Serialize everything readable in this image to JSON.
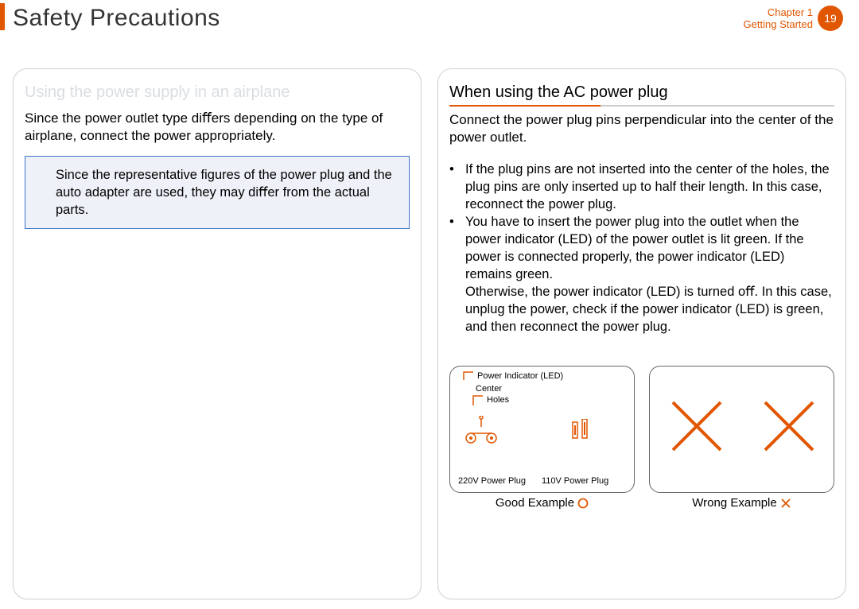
{
  "page": {
    "title": "Safety Precautions",
    "chapter_line1": "Chapter 1",
    "chapter_line2": "Getting Started",
    "page_number": "19"
  },
  "left": {
    "heading": "Using the power supply in an airplane",
    "intro": "Since the power outlet type diﬀers depending on the type of airplane, connect the power appropriately.",
    "note": "Since the representative ﬁgures of the power plug and the auto adapter are used, they may diﬀer from the actual parts."
  },
  "right": {
    "heading": "When using the AC power plug",
    "intro": "Connect the power plug pins perpendicular into the center of the power outlet.",
    "bullet1": "If the plug pins are not inserted into the center of the holes, the plug pins are only inserted up to half their length. In this case, reconnect the power plug.",
    "bullet2a": "You have to insert the power plug into the outlet when the power indicator (LED) of the power outlet is lit green. If the power is connected properly, the power indicator (LED) remains green.",
    "bullet2b": "Otherwise, the power indicator (LED) is turned oﬀ. In this case, unplug the power, check if the power indicator (LED) is green, and then reconnect the power plug."
  },
  "figure": {
    "led_label": "Power Indicator (LED)",
    "center_label": "Center",
    "holes_label": "Holes",
    "plug_220": "220V Power Plug",
    "plug_110": "110V Power Plug",
    "good_caption": "Good Example",
    "wrong_caption": "Wrong Example"
  }
}
